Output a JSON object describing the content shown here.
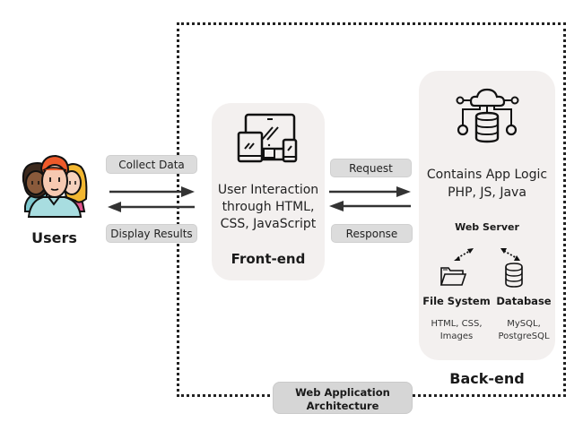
{
  "title": "Web Application Architecture",
  "users": {
    "label": "Users",
    "icon": "users-group-icon"
  },
  "user_to_frontend": {
    "top_label": "Collect Data",
    "bottom_label": "Display Results"
  },
  "frontend": {
    "icon": "multi-device-icon",
    "description_lines": [
      "User Interaction",
      "through HTML,",
      "CSS, JavaScript"
    ],
    "label": "Front-end"
  },
  "frontend_to_backend": {
    "top_label": "Request",
    "bottom_label": "Response"
  },
  "backend": {
    "icon": "cloud-database-network-icon",
    "description_lines": [
      "Contains App Logic",
      "PHP, JS, Java"
    ],
    "server_label": "Web Server",
    "file_system": {
      "label": "File System",
      "icon": "folder-icon",
      "details_lines": [
        "HTML, CSS,",
        "Images"
      ]
    },
    "database": {
      "label": "Database",
      "icon": "database-icon",
      "details_lines": [
        "MySQL,",
        "PostgreSQL"
      ]
    },
    "label": "Back-end"
  },
  "colors": {
    "card_bg": "#f3f0ef",
    "pill_bg": "#dcdcdc",
    "arrow": "#333333",
    "frame": "#222222"
  }
}
